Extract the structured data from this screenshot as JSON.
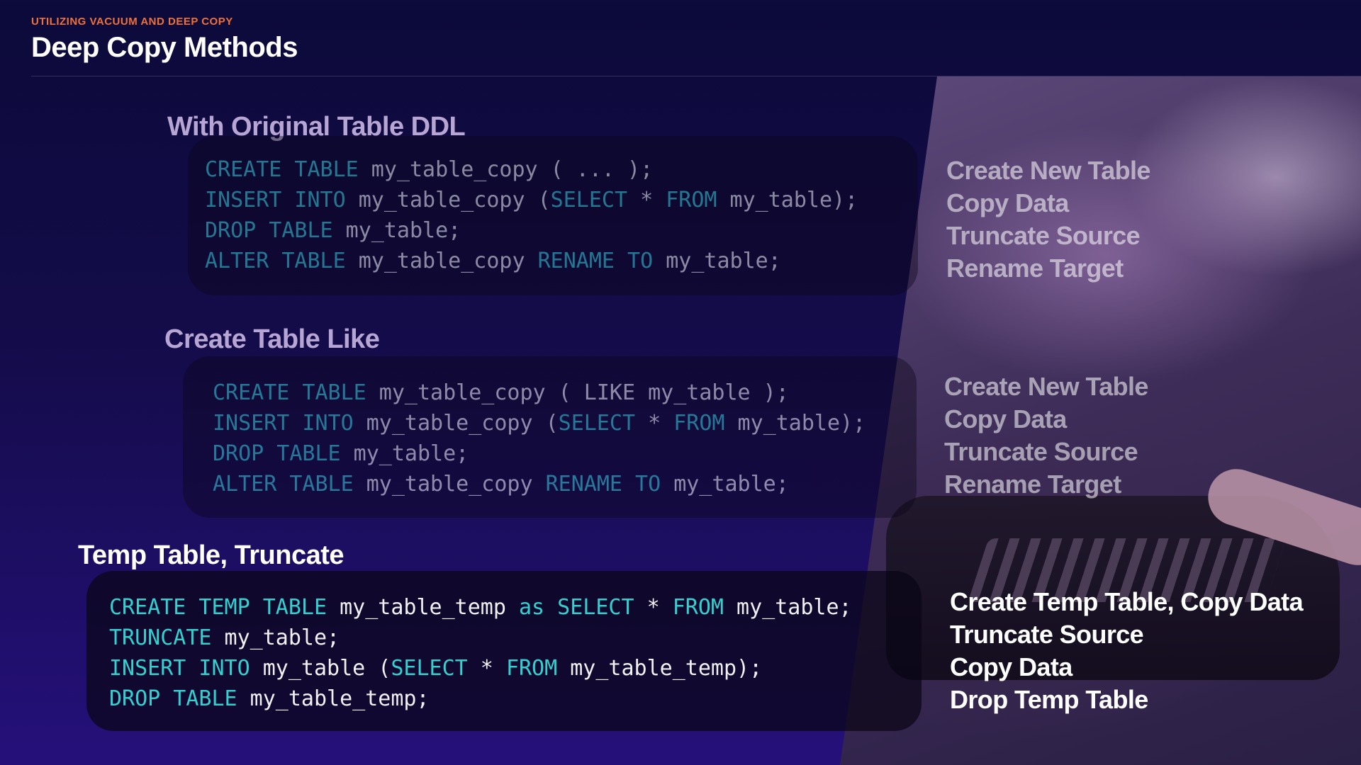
{
  "header": {
    "eyebrow": "UTILIZING VACUUM AND DEEP COPY",
    "title": "Deep Copy Methods"
  },
  "colors": {
    "accent_orange": "#f0703a",
    "keyword_teal": "#33d0d0",
    "code_text": "#f0f0f0",
    "dim_title": "#b7a6d3",
    "background_navy": "#0c0a3a"
  },
  "sections": [
    {
      "title": "With Original Table DDL",
      "code": [
        [
          {
            "kw": true,
            "t": "CREATE TABLE"
          },
          {
            "kw": false,
            "t": " my_table_copy ( ... );"
          }
        ],
        [
          {
            "kw": true,
            "t": "INSERT INTO"
          },
          {
            "kw": false,
            "t": " my_table_copy ("
          },
          {
            "kw": true,
            "t": "SELECT"
          },
          {
            "kw": false,
            "t": " * "
          },
          {
            "kw": true,
            "t": "FROM"
          },
          {
            "kw": false,
            "t": " my_table);"
          }
        ],
        [
          {
            "kw": true,
            "t": "DROP TABLE"
          },
          {
            "kw": false,
            "t": " my_table;"
          }
        ],
        [
          {
            "kw": true,
            "t": "ALTER TABLE"
          },
          {
            "kw": false,
            "t": " my_table_copy "
          },
          {
            "kw": true,
            "t": "RENAME TO"
          },
          {
            "kw": false,
            "t": " my_table;"
          }
        ]
      ],
      "steps": [
        "Create New Table",
        "Copy Data",
        "Truncate Source",
        "Rename Target"
      ]
    },
    {
      "title": "Create Table Like",
      "code": [
        [
          {
            "kw": true,
            "t": "CREATE TABLE"
          },
          {
            "kw": false,
            "t": " my_table_copy ( LIKE my_table );"
          }
        ],
        [
          {
            "kw": true,
            "t": "INSERT INTO"
          },
          {
            "kw": false,
            "t": " my_table_copy ("
          },
          {
            "kw": true,
            "t": "SELECT"
          },
          {
            "kw": false,
            "t": " * "
          },
          {
            "kw": true,
            "t": "FROM"
          },
          {
            "kw": false,
            "t": " my_table);"
          }
        ],
        [
          {
            "kw": true,
            "t": "DROP TABLE"
          },
          {
            "kw": false,
            "t": " my_table;"
          }
        ],
        [
          {
            "kw": true,
            "t": "ALTER TABLE"
          },
          {
            "kw": false,
            "t": " my_table_copy "
          },
          {
            "kw": true,
            "t": "RENAME TO"
          },
          {
            "kw": false,
            "t": " my_table;"
          }
        ]
      ],
      "steps": [
        "Create New Table",
        "Copy Data",
        "Truncate Source",
        "Rename Target"
      ]
    },
    {
      "title": "Temp Table, Truncate",
      "code": [
        [
          {
            "kw": true,
            "t": "CREATE TEMP TABLE"
          },
          {
            "kw": false,
            "t": " my_table_temp "
          },
          {
            "kw": true,
            "t": "as SELECT"
          },
          {
            "kw": false,
            "t": " * "
          },
          {
            "kw": true,
            "t": "FROM"
          },
          {
            "kw": false,
            "t": " my_table;"
          }
        ],
        [
          {
            "kw": true,
            "t": "TRUNCATE"
          },
          {
            "kw": false,
            "t": " my_table;"
          }
        ],
        [
          {
            "kw": true,
            "t": "INSERT INTO"
          },
          {
            "kw": false,
            "t": " my_table ("
          },
          {
            "kw": true,
            "t": "SELECT"
          },
          {
            "kw": false,
            "t": " * "
          },
          {
            "kw": true,
            "t": "FROM"
          },
          {
            "kw": false,
            "t": " my_table_temp);"
          }
        ],
        [
          {
            "kw": true,
            "t": "DROP TABLE"
          },
          {
            "kw": false,
            "t": " my_table_temp;"
          }
        ]
      ],
      "steps": [
        "Create Temp Table, Copy Data",
        "Truncate Source",
        "Copy Data",
        "Drop Temp Table"
      ]
    }
  ]
}
